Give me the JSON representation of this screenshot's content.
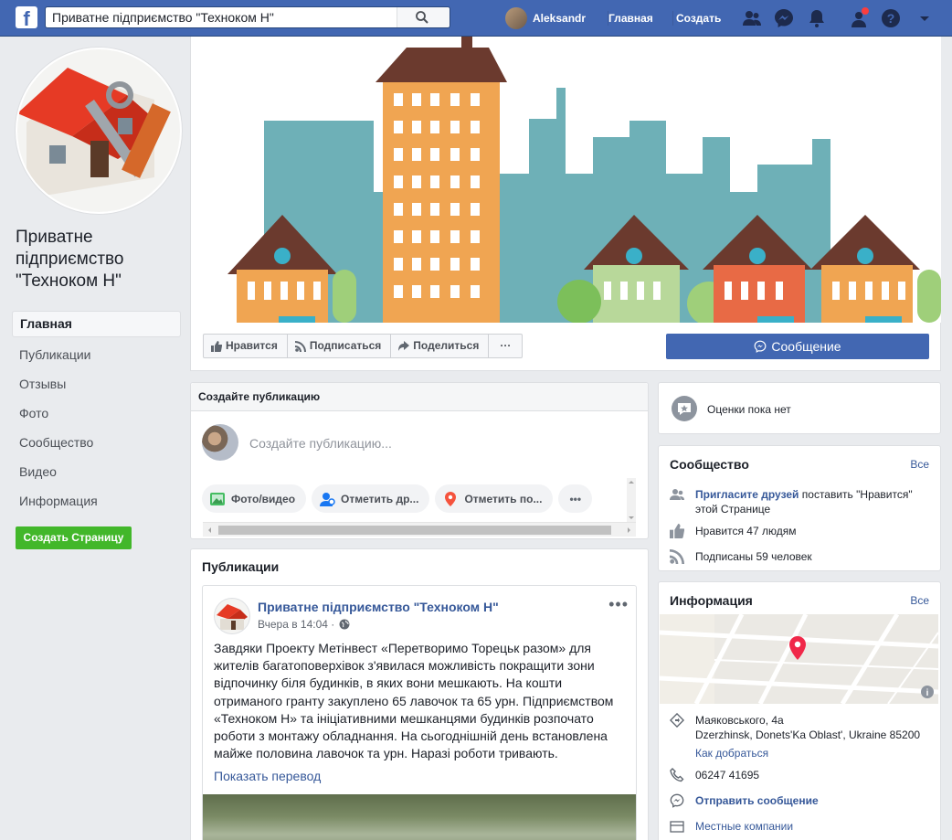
{
  "topbar": {
    "logo": "f",
    "search_value": "Приватне підприємство \"Техноком Н\"",
    "user_name": "Aleksandr",
    "nav_home": "Главная",
    "nav_create": "Создать",
    "icons": [
      "friends-icon",
      "messenger-icon",
      "notifications-icon",
      "friend-requests-icon",
      "help-icon",
      "dropdown-arrow-icon"
    ]
  },
  "page": {
    "name": "Приватне підприємство \"Техноком Н\""
  },
  "left_nav": {
    "items": [
      "Главная",
      "Публикации",
      "Отзывы",
      "Фото",
      "Сообщество",
      "Видео",
      "Информация"
    ],
    "create_page": "Создать Страницу"
  },
  "cover_actions": {
    "like": "Нравится",
    "follow": "Подписаться",
    "share": "Поделиться",
    "more": "···",
    "message": "Сообщение"
  },
  "create_post": {
    "title": "Создайте публикацию",
    "placeholder": "Создайте публикацию...",
    "chips": [
      "Фото/видео",
      "Отметить др...",
      "Отметить по..."
    ],
    "more": "•••"
  },
  "publications": {
    "title": "Публикации",
    "post": {
      "author": "Приватне підприємство \"Техноком Н\"",
      "time": "Вчера в 14:04 ·",
      "text": "Завдяки Проекту Метінвест «Перетворимо Торецьк разом» для жителів багатоповерхівок з'явилася можливість покращити зони відпочинку біля будинків, в яких вони мешкають. На кошти отриманого гранту закуплено 65 лавочок та 65 урн. Підприємством «Техноком Н» та ініціативними мешканцями будинків розпочато роботи з монтажу обладнання. На сьогоднішній день встановлена майже половина лавочок та урн. Наразі роботи тривають.",
      "translate": "Показать перевод"
    }
  },
  "rating": {
    "text": "Оценки пока нет"
  },
  "community": {
    "title": "Сообщество",
    "all": "Все",
    "invite_link": "Пригласите друзей",
    "invite_text": " поставить \"Нравится\" этой Странице",
    "likes": "Нравится 47 людям",
    "followers": "Подписаны 59 человек"
  },
  "info": {
    "title": "Информация",
    "all": "Все",
    "address_line1": "Маяковського, 4а",
    "address_line2": "Dzerzhinsk, Donets'Ka Oblast', Ukraine 85200",
    "directions": "Как добраться",
    "phone": "06247 41695",
    "send_message": "Отправить сообщение",
    "local": "Местные компании"
  },
  "colors": {
    "brand": "#4267b2",
    "link": "#365899",
    "green": "#42b72a",
    "background": "#e9ebee"
  }
}
